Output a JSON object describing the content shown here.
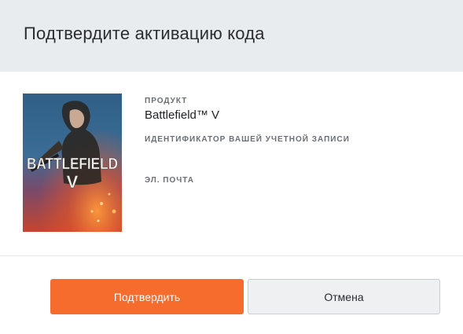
{
  "dialog": {
    "title": "Подтвердите активацию кода"
  },
  "product": {
    "label": "ПРОДУКТ",
    "name": "Battlefield™ V",
    "cover_title_line1": "BATTLEFIELD",
    "cover_title_line2": "V"
  },
  "account": {
    "label": "ИДЕНТИФИКАТОР ВАШЕЙ УЧЕТНОЙ ЗАПИСИ",
    "value": ""
  },
  "email": {
    "label": "ЭЛ. ПОЧТА",
    "value": ""
  },
  "buttons": {
    "confirm_label": "Подтвердить",
    "cancel_label": "Отмена"
  },
  "colors": {
    "header_bg": "#e9ecee",
    "confirm_bg": "#f56c2d",
    "cancel_bg": "#eef0f1"
  }
}
